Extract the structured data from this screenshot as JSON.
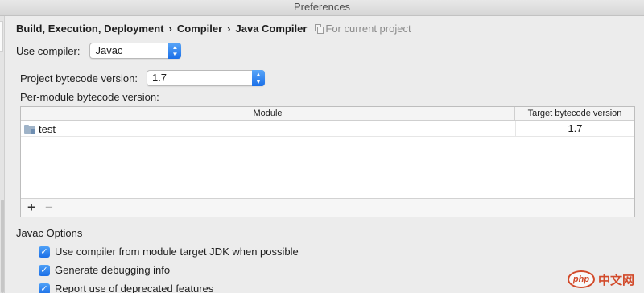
{
  "window": {
    "title": "Preferences"
  },
  "breadcrumb": {
    "items": [
      "Build, Execution, Deployment",
      "Compiler",
      "Java Compiler"
    ],
    "separator": "›",
    "scope_label": "For current project"
  },
  "use_compiler": {
    "label": "Use compiler:",
    "value": "Javac"
  },
  "project_bytecode": {
    "label": "Project bytecode version:",
    "value": "1.7"
  },
  "per_module": {
    "label": "Per-module bytecode version:"
  },
  "table": {
    "columns": [
      "Module",
      "Target bytecode version"
    ],
    "rows": [
      {
        "module": "test",
        "target": "1.7"
      }
    ],
    "toolbar": {
      "add": "+",
      "remove": "−"
    }
  },
  "javac_options": {
    "title": "Javac Options",
    "checkboxes": [
      {
        "label": "Use compiler from module target JDK when possible",
        "checked": true
      },
      {
        "label": "Generate debugging info",
        "checked": true
      },
      {
        "label": "Report use of deprecated features",
        "checked": true
      }
    ]
  },
  "watermark": {
    "logo_text": "php",
    "text": "中文网"
  },
  "colors": {
    "accent": "#1b6fe7",
    "background": "#ececec",
    "watermark": "#d24a2a"
  }
}
